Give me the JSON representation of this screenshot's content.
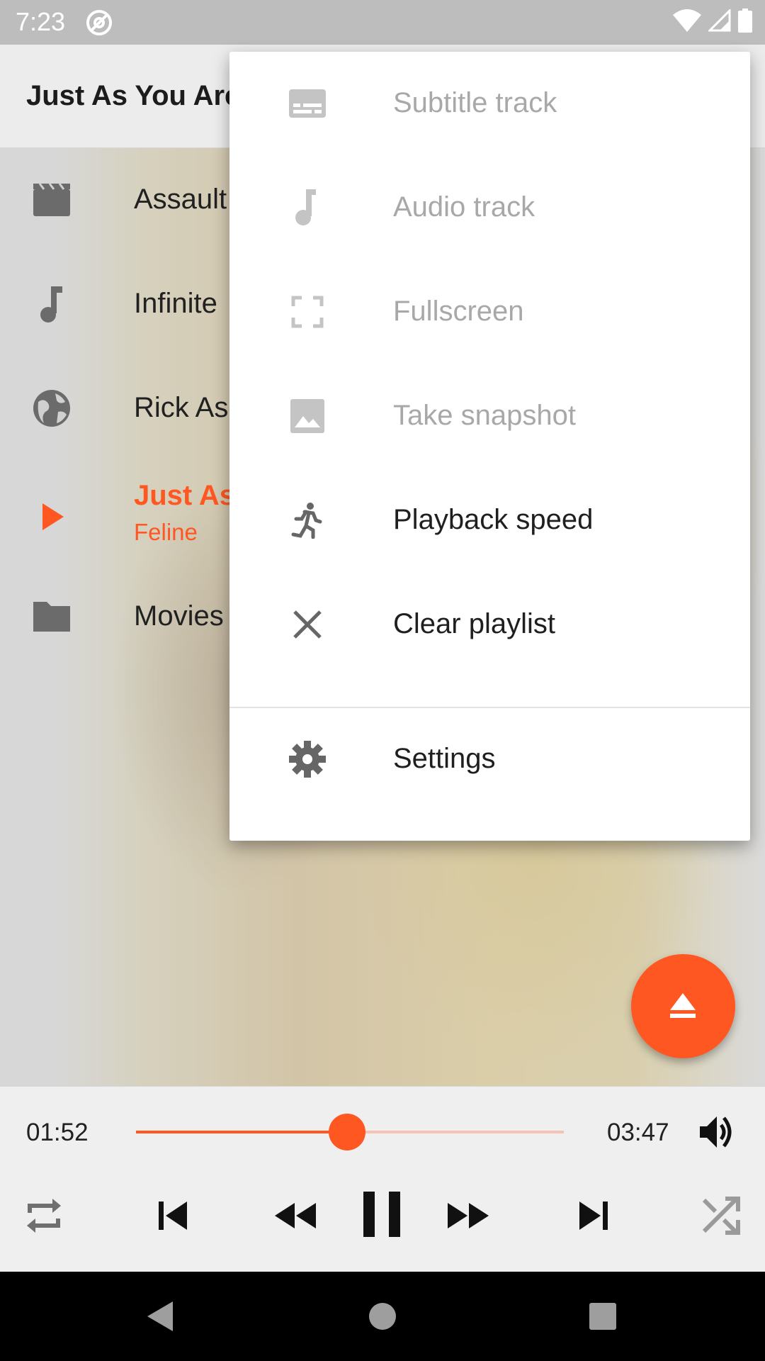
{
  "status_bar": {
    "time": "7:23"
  },
  "app_bar": {
    "title": "Just As You Are"
  },
  "playlist": {
    "items": [
      {
        "label": "Assault",
        "icon": "movie-icon"
      },
      {
        "label": "Infinite",
        "icon": "music-note-icon"
      },
      {
        "label": "Rick As",
        "icon": "globe-icon"
      },
      {
        "label": "Just As",
        "subtitle": "Feline",
        "icon": "play-icon",
        "active": true
      },
      {
        "label": "Movies",
        "icon": "folder-icon"
      }
    ]
  },
  "menu": {
    "items": [
      {
        "label": "Subtitle track",
        "icon": "subtitles-icon",
        "enabled": false
      },
      {
        "label": "Audio track",
        "icon": "music-note-icon",
        "enabled": false
      },
      {
        "label": "Fullscreen",
        "icon": "fullscreen-icon",
        "enabled": false
      },
      {
        "label": "Take snapshot",
        "icon": "image-icon",
        "enabled": false
      },
      {
        "label": "Playback speed",
        "icon": "running-icon",
        "enabled": true
      },
      {
        "label": "Clear playlist",
        "icon": "close-icon",
        "enabled": true
      },
      {
        "label": "Settings",
        "icon": "gear-icon",
        "enabled": true
      }
    ]
  },
  "player": {
    "current_time": "01:52",
    "total_time": "03:47",
    "progress": 0.4934
  },
  "colors": {
    "accent": "#ff5722",
    "menu_disabled": "#a8a8a8",
    "menu_text": "#1f1f1f"
  }
}
